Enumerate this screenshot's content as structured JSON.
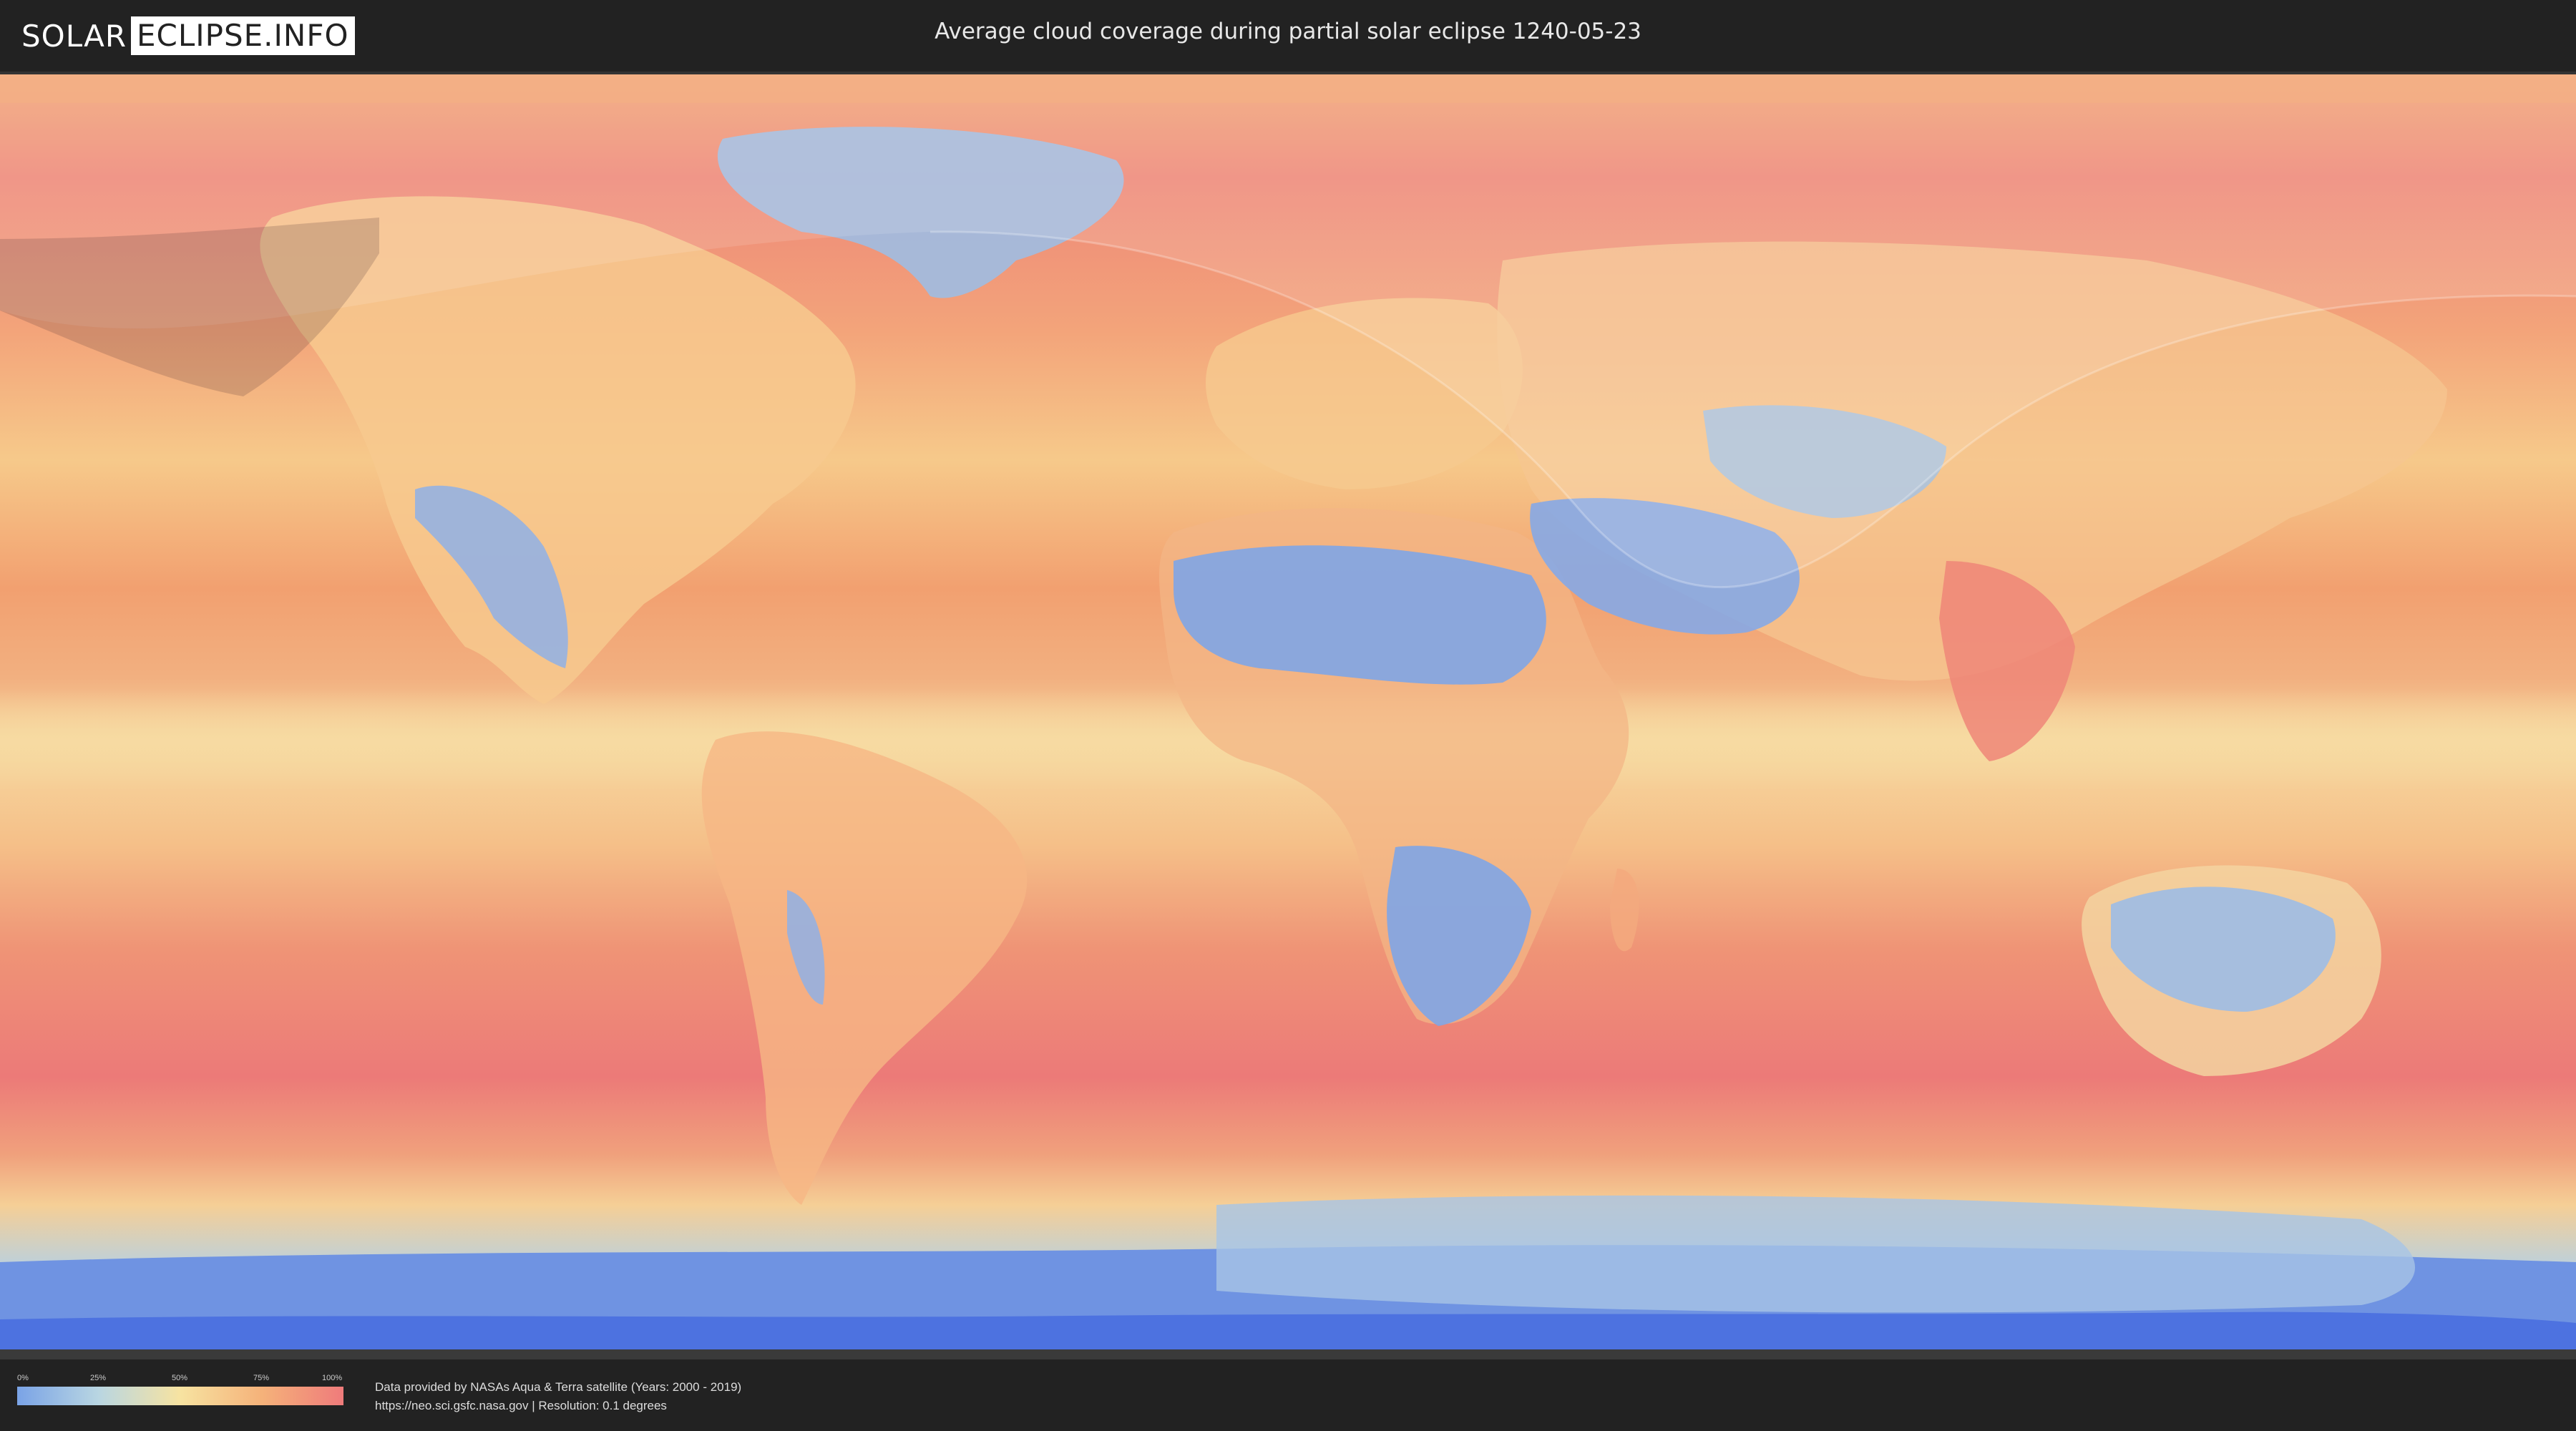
{
  "header": {
    "logo_part1": "SOLAR",
    "logo_part2": "ECLIPSE.INFO",
    "title": "Average cloud coverage during partial solar eclipse 1240-05-23"
  },
  "legend": {
    "ticks": [
      "0%",
      "25%",
      "50%",
      "75%",
      "100%"
    ],
    "gradient_colors": [
      "#7aa3e6",
      "#b9d6e2",
      "#f7e3a1",
      "#f5b27a",
      "#ef7b7b"
    ]
  },
  "credits": {
    "line1": "Data provided by NASAs Aqua & Terra satellite (Years: 2000 - 2019)",
    "line2": "https://neo.sci.gsfc.nasa.gov | Resolution: 0.1 degrees"
  },
  "colors": {
    "header_bg": "#222222",
    "high_cloud": "#ef7b7b",
    "mid_cloud": "#f7c98a",
    "low_cloud": "#7aa3e6"
  }
}
